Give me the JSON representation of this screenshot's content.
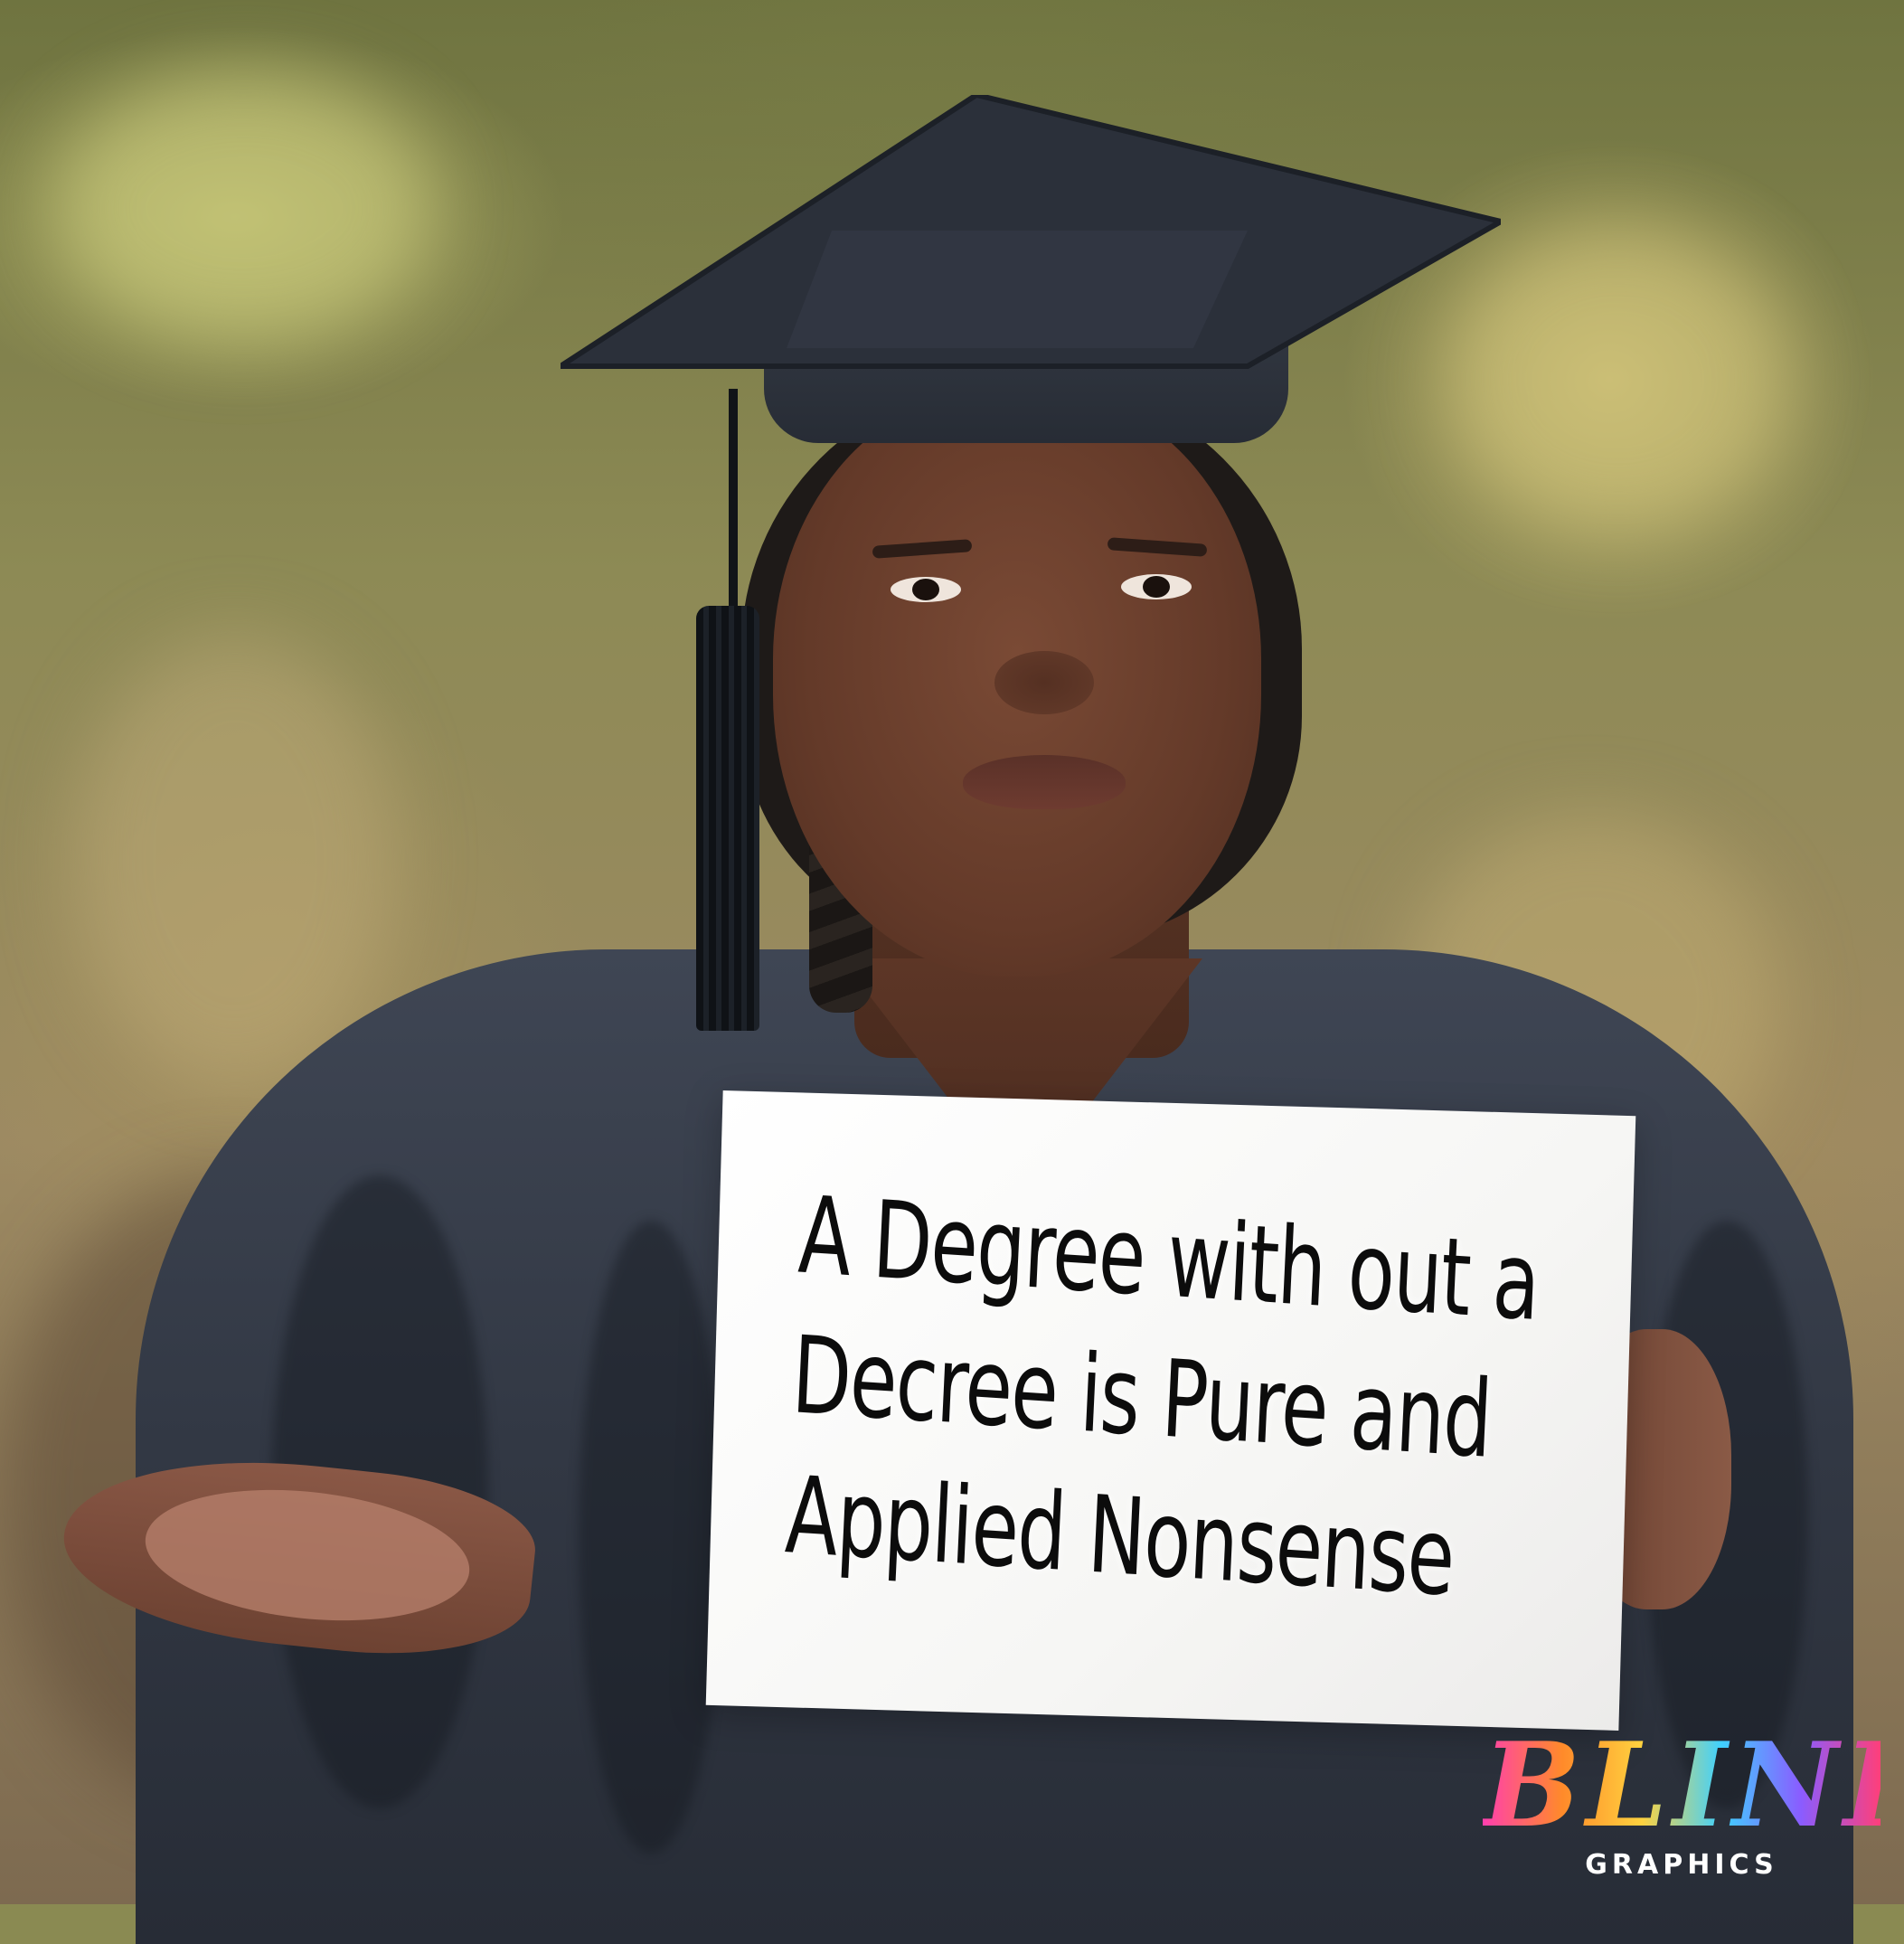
{
  "sign": {
    "lines": [
      "A Degree with out a",
      "Decree is Pure and",
      "Applied Nonsense"
    ]
  },
  "logo": {
    "word": "BLINK",
    "sub": "GRAPHICS",
    "colors": [
      "#ff3fae",
      "#ff8a2a",
      "#ffd23f",
      "#3fd1ff",
      "#8a5cff"
    ]
  },
  "colors": {
    "gown": "#323844",
    "cap": "#272c35",
    "sign_paper": "#f6f6f4",
    "sign_text": "#0c0c0c",
    "background_foliage": "#8d8a55"
  }
}
